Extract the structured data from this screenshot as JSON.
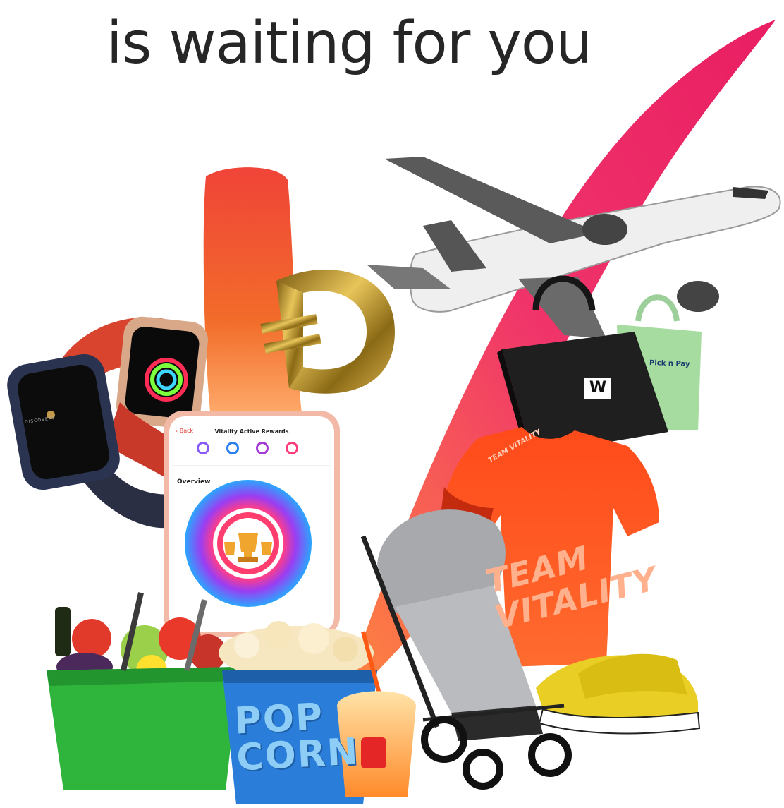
{
  "headline": "is waiting for you",
  "phone": {
    "back_label": "‹ Back",
    "screen_title": "Vitality Active Rewards",
    "overview_label": "Overview",
    "tab_icons": [
      "activity-tab-icon",
      "rewards-tab-icon",
      "goals-tab-icon",
      "profile-tab-icon"
    ]
  },
  "bags": {
    "black_bag_logo": "W",
    "green_bag_text": "Pick n Pay"
  },
  "shirt": {
    "big_text_line1": "TEAM",
    "big_text_line2": "VITALITY",
    "small_text": "TEAM VITALITY"
  },
  "popcorn": {
    "line1": "POP",
    "line2": "CORN"
  },
  "watch": {
    "brand": "DISCOVERY"
  },
  "colors": {
    "accent_pink": "#e91e63",
    "accent_orange": "#f26522",
    "accent_red": "#e53935",
    "gold": "#c9a227"
  }
}
